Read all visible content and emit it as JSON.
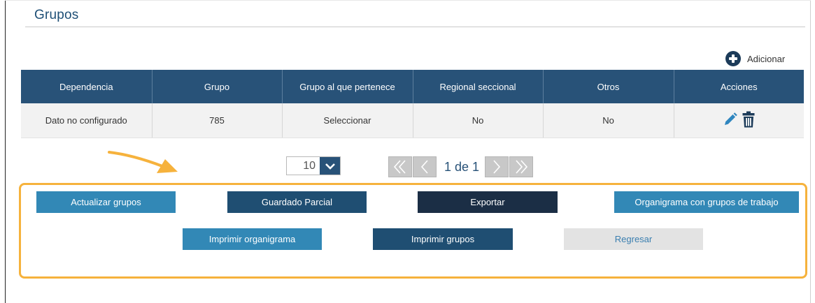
{
  "section": {
    "title": "Grupos"
  },
  "add": {
    "label": "Adicionar",
    "icon": "plus-circle-icon"
  },
  "table": {
    "headers": [
      "Dependencia",
      "Grupo",
      "Grupo al que pertenece",
      "Regional seccional",
      "Otros",
      "Acciones"
    ],
    "rows": [
      {
        "dependencia": "Dato no configurado",
        "grupo": "785",
        "pertenece": "Seleccionar",
        "regional": "No",
        "otros": "No",
        "actions": [
          "edit-icon",
          "delete-icon"
        ]
      }
    ]
  },
  "pagination": {
    "page_size": "10",
    "page_label": "1 de 1",
    "buttons": [
      "first-page-icon",
      "prev-page-icon",
      "next-page-icon",
      "last-page-icon"
    ]
  },
  "actions": {
    "update_groups": "Actualizar grupos",
    "partial_save": "Guardado Parcial",
    "export": "Exportar",
    "org_chart_workgroups": "Organigrama con grupos de trabajo",
    "print_org_chart": "Imprimir organigrama",
    "print_groups": "Imprimir grupos",
    "back": "Regresar"
  },
  "colors": {
    "header_blue": "#285278",
    "button_light": "#3288b6",
    "button_dark": "#1f4e72",
    "button_darker": "#1b2e45",
    "highlight": "#f6b23c"
  }
}
